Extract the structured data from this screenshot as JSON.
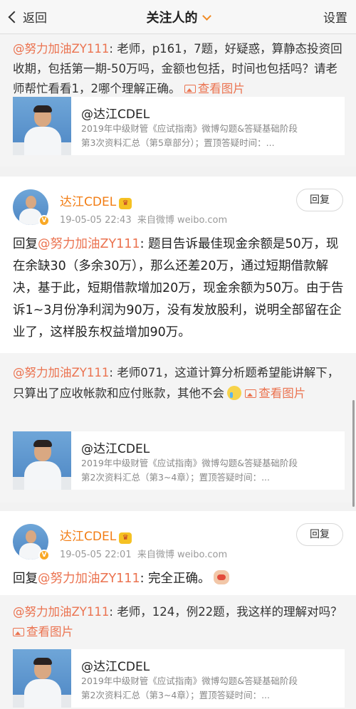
{
  "nav": {
    "back_label": "返回",
    "title": "关注人的",
    "settings_label": "设置"
  },
  "post1": {
    "quote": {
      "mention": "@努力加油ZY111",
      "text": ": 老师，p161，7题，好疑惑，算静态投资回收期，包括第一期-50万吗，金额也包括，时间也包括吗？请老师帮忙看看1，2哪个理解正确。",
      "picture_link": "查看图片"
    },
    "share": {
      "name": "@达江CDEL",
      "desc_line1": "2019年中级财管《应试指南》微博勾题&答疑基础阶段",
      "desc_line2": "第3次资料汇总（第5章部分）；置顶答疑时间：..."
    }
  },
  "post2": {
    "author": "达江CDEL",
    "time": "19-05-05 22:43",
    "source": "来自微博 weibo.com",
    "reply_button": "回复",
    "body_prefix": "回复",
    "body_mention": "@努力加油ZY111",
    "body_text": ": 题目告诉最佳现金余额是50万，现在余缺30（多余30万），那么还差20万，通过短期借款解决，基于此，短期借款增加20万，现金余额为50万。由于告诉1~3月份净利润为90万，没有发放股利，说明全部留在企业了，这样股东权益增加90万。",
    "quote": {
      "mention": "@努力加油ZY111",
      "text": ": 老师071，这道计算分析题希望能讲解下，只算出了应收帐款和应付账款，其他不会",
      "picture_link": "查看图片"
    },
    "share": {
      "name": "@达江CDEL",
      "desc_line1": "2019年中级财管《应试指南》微博勾题&答疑基础阶段",
      "desc_line2": "第2次资料汇总（第3~4章）；置顶答疑时间：..."
    }
  },
  "post3": {
    "author": "达江CDEL",
    "time": "19-05-05 22:01",
    "source": "来自微博 weibo.com",
    "reply_button": "回复",
    "body_prefix": "回复",
    "body_mention": "@努力加油ZY111",
    "body_text": ": 完全正确。",
    "quote": {
      "mention": "@努力加油ZY111",
      "text": ": 老师，124，例22题，我这样的理解对吗？",
      "picture_link": "查看图片"
    },
    "share": {
      "name": "@达江CDEL",
      "desc_line1": "2019年中级财管《应试指南》微博勾题&答疑基础阶段",
      "desc_line2": "第2次资料汇总（第3~4章）；置顶答疑时间：..."
    }
  },
  "colors": {
    "accent": "#eb7350",
    "author": "#f27d14",
    "badge": "#f9a825"
  },
  "icons": {
    "back": "chevron-left-icon",
    "title_dropdown": "chevron-down-icon",
    "picture": "picture-icon",
    "verified": "verified-badge-icon",
    "member": "crown-icon"
  }
}
